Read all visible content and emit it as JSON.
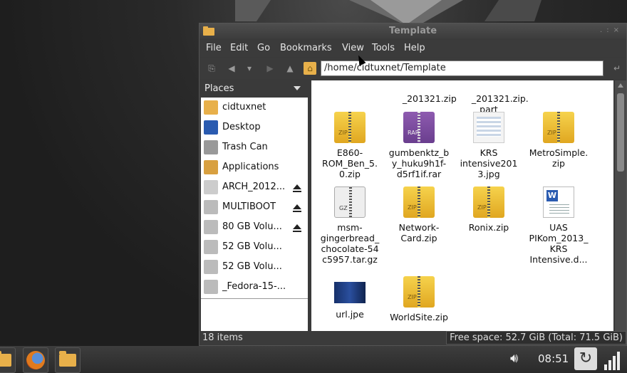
{
  "window": {
    "title": "Template",
    "menus": [
      "File",
      "Edit",
      "Go",
      "Bookmarks",
      "View",
      "Tools",
      "Help"
    ],
    "path": "/home/cidtuxnet/Template"
  },
  "sidebar": {
    "header": "Places",
    "items": [
      {
        "label": "cidtuxnet",
        "icon": "home-icon",
        "eject": false
      },
      {
        "label": "Desktop",
        "icon": "desktop-icon",
        "eject": false
      },
      {
        "label": "Trash Can",
        "icon": "trash-icon",
        "eject": false
      },
      {
        "label": "Applications",
        "icon": "applications-icon",
        "eject": false
      },
      {
        "label": "ARCH_2012...",
        "icon": "optical-drive-icon",
        "eject": true
      },
      {
        "label": "MULTIBOOT",
        "icon": "drive-icon",
        "eject": true
      },
      {
        "label": "80 GB Volu...",
        "icon": "drive-icon",
        "eject": true
      },
      {
        "label": "52 GB Volu...",
        "icon": "drive-icon",
        "eject": false
      },
      {
        "label": "52 GB Volu...",
        "icon": "drive-icon",
        "eject": false
      },
      {
        "label": "_Fedora-15-...",
        "icon": "drive-icon",
        "eject": false
      }
    ]
  },
  "files": {
    "partial_row": [
      "_201321.zip",
      "_201321.zip.\npart"
    ],
    "items": [
      {
        "name": "E860-\nROM_Ben_5.\n0.zip",
        "kind": "zip"
      },
      {
        "name": "gumbenktz_b\ny_huku9h1f-\nd5rf1if.rar",
        "kind": "rar"
      },
      {
        "name": "KRS\nintensive201\n3.jpg",
        "kind": "jpg"
      },
      {
        "name": "MetroSimple.\nzip",
        "kind": "zip"
      },
      {
        "name": "msm-\ngingerbread_\nchocolate-54\nc5957.tar.gz",
        "kind": "gz"
      },
      {
        "name": "Network-\nCard.zip",
        "kind": "zip"
      },
      {
        "name": "Ronix.zip",
        "kind": "zip"
      },
      {
        "name": "UAS\nPIKom_2013_\nKRS\nIntensive.d...",
        "kind": "doc"
      },
      {
        "name": "url.jpe",
        "kind": "photo"
      },
      {
        "name": "WorldSite.zip",
        "kind": "zip"
      }
    ],
    "icon_text": {
      "zip": "ZIP",
      "rar": "RAR",
      "gz": "GZ",
      "doc": "W"
    }
  },
  "status": {
    "items": "18 items",
    "free": "Free space: 52.7 GiB (Total: 71.5 GiB)"
  },
  "taskbar": {
    "clock": "08:51"
  },
  "colors": {
    "zip": "#e0a721",
    "rar": "#6a3e8e",
    "accent": "#e8b04a"
  }
}
